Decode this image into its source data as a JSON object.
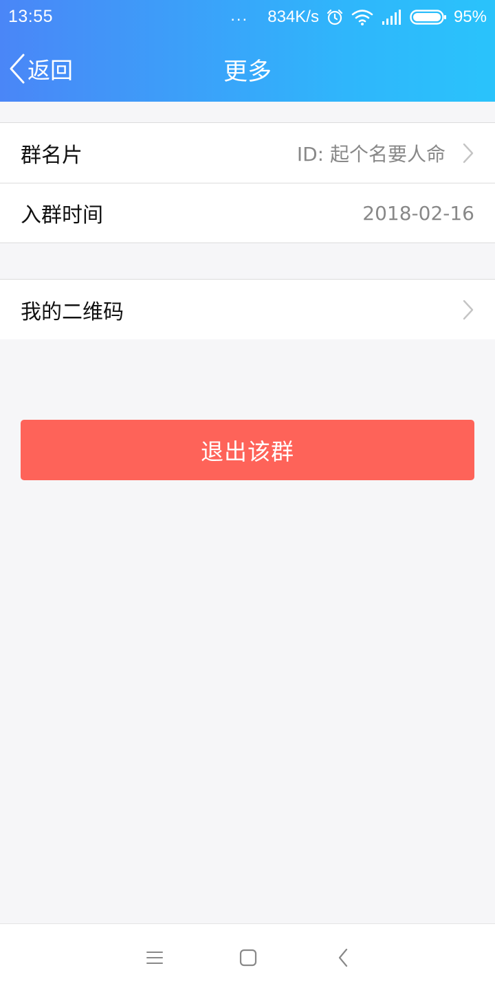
{
  "status_bar": {
    "time": "13:55",
    "dots": "...",
    "network_speed": "834K/s",
    "battery": "95%"
  },
  "nav": {
    "back_label": "返回",
    "title": "更多"
  },
  "group1": {
    "rows": [
      {
        "label": "群名片",
        "value": "ID: 起个名要人命",
        "has_chevron": true
      },
      {
        "label": "入群时间",
        "value": "2018-02-16",
        "has_chevron": false
      }
    ]
  },
  "group2": {
    "rows": [
      {
        "label": "我的二维码",
        "value": "",
        "has_chevron": true
      }
    ]
  },
  "exit_button_label": "退出该群",
  "icons": {
    "back": "chevron-left-icon",
    "row_arrow": "chevron-right-icon",
    "alarm": "alarm-icon",
    "wifi": "wifi-icon",
    "signal": "signal-icon",
    "battery": "battery-icon",
    "menu": "menu-icon",
    "home": "home-square-icon",
    "sys_back": "back-icon"
  },
  "colors": {
    "header_start": "#4a86f7",
    "header_end": "#2ac3fb",
    "exit_button": "#fe6359",
    "background": "#f6f6f8"
  }
}
